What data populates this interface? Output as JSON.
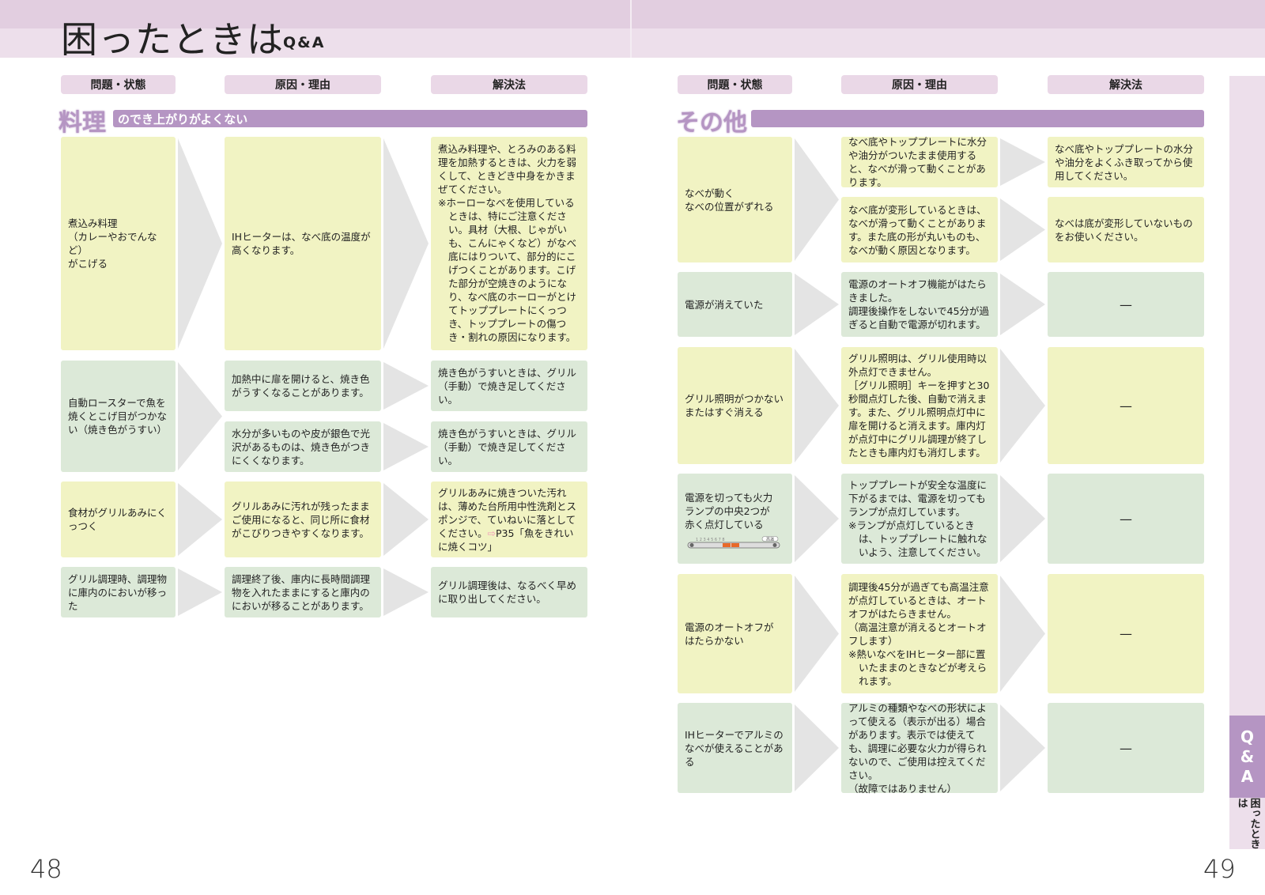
{
  "title": {
    "main": "困ったときは",
    "sub": "Q&A"
  },
  "headers": {
    "problem": "問題・状態",
    "cause": "原因・理由",
    "solution": "解決法"
  },
  "left": {
    "section": {
      "big": "料理",
      "bar": "のでき上がりがよくない"
    },
    "rows": [
      {
        "problem": "煮込み料理\n（カレーやおでんなど）\nがこげる",
        "cause": "IHヒーターは、なべ底の温度が高くなります。",
        "solution": "煮込み料理や、とろみのある料理を加熱するときは、火力を弱くして、ときどき中身をかきまぜてください。",
        "solution_note": "※ホーローなべを使用しているときは、特にご注意ください。具材（大根、じゃがいも、こんにゃくなど）がなべ底にはりついて、部分的にこげつくことがあります。こげた部分が空焼きのようになり、なべ底のホーローがとけてトッププレートにくっつき、トッププレートの傷つき・割れの原因になります。"
      },
      {
        "problem": "自動ロースターで魚を焼くとこげ目がつかない（焼き色がうすい）",
        "cause1": "加熱中に扉を開けると、焼き色がうすくなることがあります。",
        "solution1": "焼き色がうすいときは、グリル（手動）で焼き足してください。",
        "cause2": "水分が多いものや皮が銀色で光沢があるものは、焼き色がつきにくくなります。",
        "solution2": "焼き色がうすいときは、グリル（手動）で焼き足してください。"
      },
      {
        "problem": "食材がグリルあみにくっつく",
        "cause": "グリルあみに汚れが残ったままご使用になると、同じ所に食材がこびりつきやすくなります。",
        "solution": "グリルあみに焼きついた汚れは、薄めた台所用中性洗剤とスポンジで、ていねいに落としてください。",
        "solution_link_arrow": "⇨",
        "solution_link": "P35「魚をきれいに焼くコツ」"
      },
      {
        "problem": "グリル調理時、調理物に庫内のにおいが移った",
        "cause": "調理終了後、庫内に長時間調理物を入れたままにすると庫内のにおいが移ることがあります。",
        "solution": "グリル調理後は、なるべく早めに取り出してください。"
      }
    ]
  },
  "right": {
    "section": {
      "big": "その他",
      "bar": ""
    },
    "rows": [
      {
        "problem": "なべが動く\nなべの位置がずれる",
        "cause1": "なべ底やトッププレートに水分や油分がついたまま使用すると、なべが滑って動くことがあります。",
        "solution1": "なべ底やトッププレートの水分や油分をよくふき取ってから使用してください。",
        "cause2": "なべ底が変形しているときは、なべが滑って動くことがあります。また底の形が丸いものも、なべが動く原因となります。",
        "solution2": "なべは底が変形していないものをお使いください。"
      },
      {
        "problem": "電源が消えていた",
        "cause": "電源のオートオフ機能がはたらきました。\n調理後操作をしないで45分が過ぎると自動で電源が切れます。",
        "solution": "—"
      },
      {
        "problem": "グリル照明がつかない\nまたはすぐ消える",
        "cause": "グリル照明は、グリル使用時以外点灯できません。\n［グリル照明］キーを押すと30秒間点灯した後、自動で消えます。また、グリル照明点灯中に扉を開けると消えます。庫内灯が点灯中にグリル調理が終了したときも庫内灯も消灯します。",
        "solution": "—"
      },
      {
        "problem": "電源を切っても火力\nランプの中央2つが\n赤く点灯している",
        "meter_scale": "1 2 3 4 5 6 7 8",
        "meter_label": "高温",
        "cause": "トッププレートが安全な温度に下がるまでは、電源を切ってもランプが点灯しています。",
        "cause_note": "※ランプが点灯しているときは、トッププレートに触れないよう、注意してください。",
        "solution": "—"
      },
      {
        "problem": "電源のオートオフが\nはたらかない",
        "cause": "調理後45分が過ぎても高温注意が点灯しているときは、オートオフがはたらきません。\n（高温注意が消えるとオートオフします）",
        "cause_note": "※熱いなべをIHヒーター部に置いたままのときなどが考えられます。",
        "solution": "—"
      },
      {
        "problem": "IHヒーターでアルミのなべが使えることがある",
        "cause": "アルミの種類やなべの形状によって使える（表示が出る）場合があります。表示では使えても、調理に必要な火力が得られないので、ご使用は控えてください。\n（故障ではありません）",
        "solution": "—"
      }
    ]
  },
  "tab": {
    "qa": [
      "Q",
      "&",
      "A"
    ],
    "label": "困ったときは"
  },
  "pages": {
    "left": "48",
    "right": "49"
  },
  "colors": {
    "accent": "#b595c3",
    "yellow": "#f1f3c3",
    "green": "#dce9d8"
  }
}
